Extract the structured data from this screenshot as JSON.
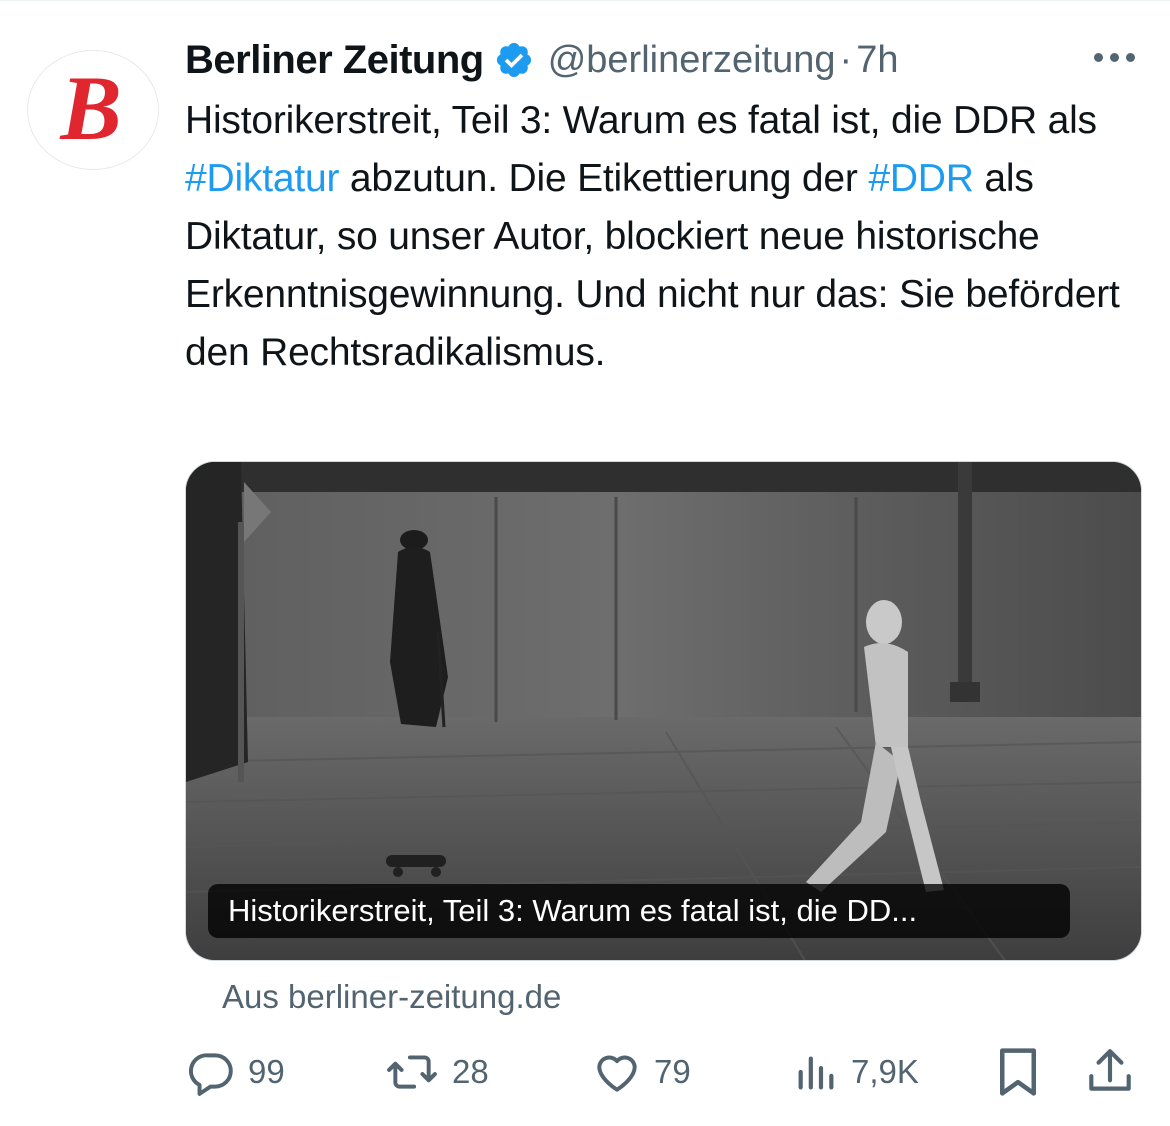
{
  "tweet": {
    "author_name": "Berliner Zeitung",
    "verified_icon": "verified-badge-icon",
    "handle": "@berlinerzeitung",
    "separator": "·",
    "time": "7h",
    "avatar_letter": "B",
    "text_parts": [
      "Historikerstreit, Teil 3: Warum es fatal ist, die DDR als ",
      "#Diktatur",
      " abzutun. Die Etikettierung der ",
      "#DDR",
      " als Diktatur, so unser Autor, blockiert neue historische Erkenntnisgewinnung. Und nicht nur das: Sie befördert den Rechtsradikalismus."
    ]
  },
  "card": {
    "caption": "Historikerstreit, Teil 3: Warum es fatal ist, die DD...",
    "source": "Aus berliner-zeitung.de"
  },
  "actions": {
    "replies": "99",
    "reposts": "28",
    "likes": "79",
    "views": "7,9K"
  },
  "colors": {
    "accent": "#1d9bf0",
    "secondary_text": "#536471",
    "logo_red": "#e0262e"
  }
}
